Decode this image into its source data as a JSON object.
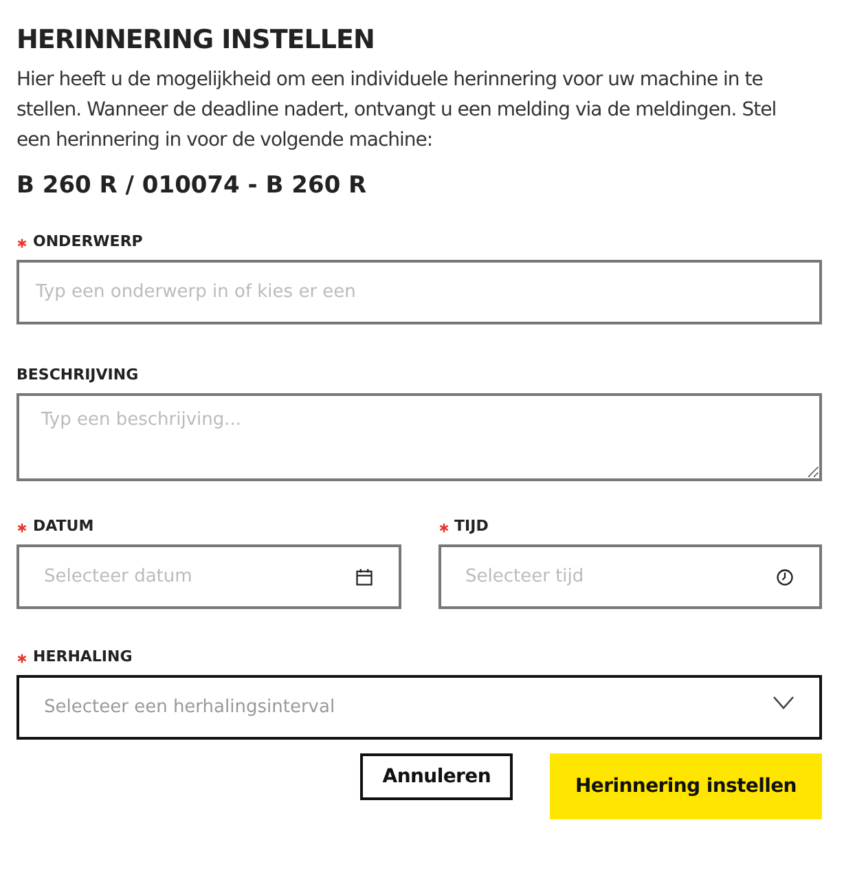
{
  "title": "HERINNERING INSTELLEN",
  "intro": "Hier heeft u de mogelijkheid om een individuele herinnering voor uw machine in te stellen. Wanneer de deadline nadert, ontvangt u een melding via de meldingen. Stel een herinnering in voor de volgende machine:",
  "machine": "B 260 R / 010074 - B 260 R",
  "field_rows": [
    {
      "fields": [
        {
          "kind": "text",
          "label": "ONDERWERP",
          "required": true,
          "placeholder": "Typ een onderwerp in of kies er een"
        }
      ]
    },
    {
      "fields": [
        {
          "kind": "textarea",
          "label": "BESCHRIJVING",
          "required": false,
          "placeholder": "Typ een beschrijving..."
        }
      ]
    },
    {
      "fields": [
        {
          "kind": "date",
          "label": "DATUM",
          "required": true,
          "placeholder": "Selecteer datum"
        },
        {
          "kind": "time",
          "label": "TIJD",
          "required": true,
          "placeholder": "Selecteer tijd"
        }
      ]
    },
    {
      "fields": [
        {
          "kind": "select",
          "label": "HERHALING",
          "required": true,
          "placeholder": "Selecteer een herhalingsinterval"
        }
      ]
    }
  ],
  "buttons": [
    {
      "kind": "secondary",
      "label": "Annuleren"
    },
    {
      "kind": "primary",
      "label": "Herinnering instellen"
    }
  ]
}
